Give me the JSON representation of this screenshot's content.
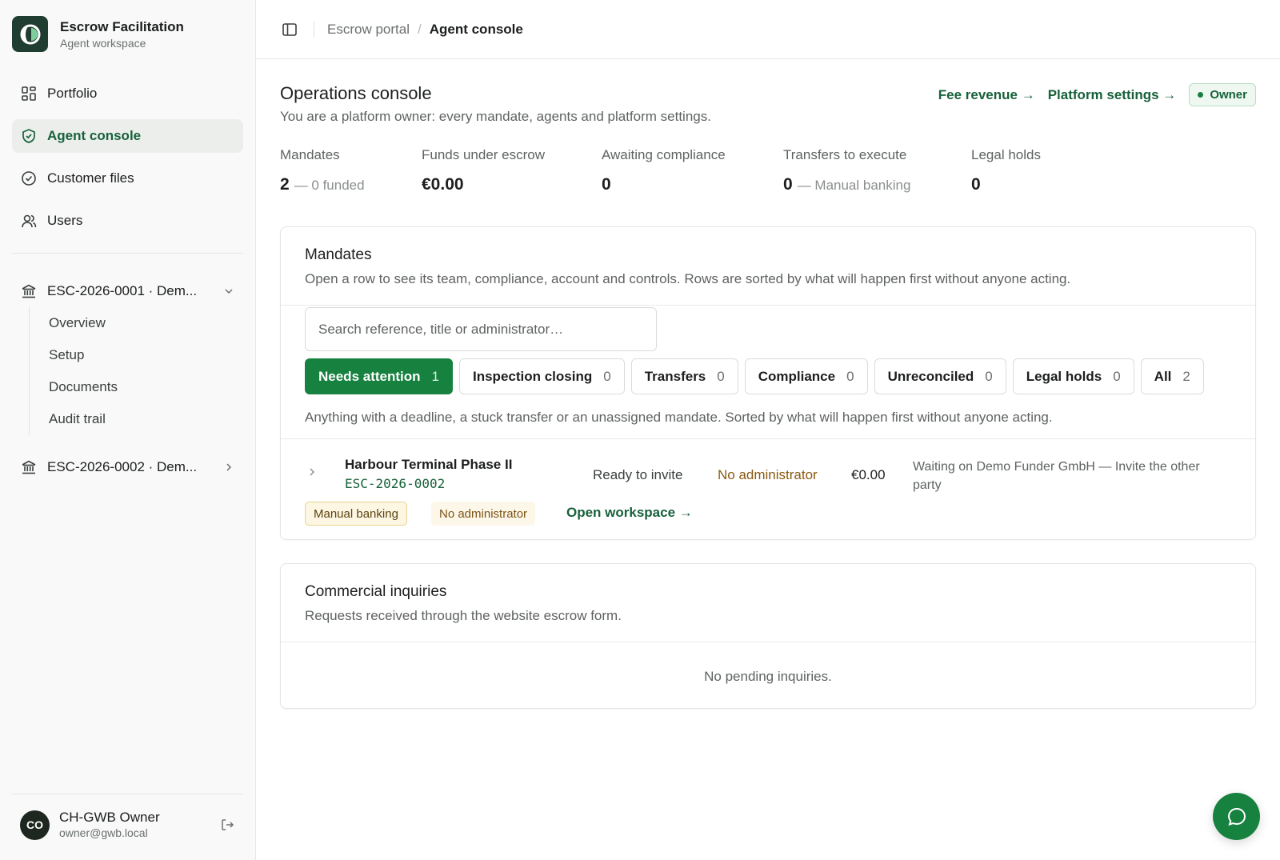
{
  "app": {
    "title": "Escrow Facilitation",
    "subtitle": "Agent workspace"
  },
  "sidebar": {
    "items": [
      {
        "label": "Portfolio",
        "icon": "grid-icon"
      },
      {
        "label": "Agent console",
        "icon": "shield-check-icon",
        "active": true
      },
      {
        "label": "Customer files",
        "icon": "check-circle-icon"
      },
      {
        "label": "Users",
        "icon": "users-icon"
      }
    ],
    "mandates": [
      {
        "label": "ESC-2026-0001 · Dem...",
        "expanded": true,
        "subitems": [
          "Overview",
          "Setup",
          "Documents",
          "Audit trail"
        ]
      },
      {
        "label": "ESC-2026-0002 · Dem...",
        "expanded": false
      }
    ],
    "user": {
      "initials": "CO",
      "name": "CH-GWB Owner",
      "email": "owner@gwb.local"
    }
  },
  "topbar": {
    "breadcrumb_root": "Escrow portal",
    "breadcrumb_separator": "/",
    "breadcrumb_current": "Agent console"
  },
  "main": {
    "title": "Operations console",
    "subtitle": "You are a platform owner: every mandate, agents and platform settings.",
    "fee_revenue_link": "Fee revenue →",
    "platform_settings_link": "Platform settings →",
    "role_badge": "Owner",
    "stats": [
      {
        "label": "Mandates",
        "value": "2",
        "note": "— 0 funded"
      },
      {
        "label": "Funds under escrow",
        "value": "€0.00",
        "note": ""
      },
      {
        "label": "Awaiting compliance",
        "value": "0",
        "note": ""
      },
      {
        "label": "Transfers to execute",
        "value": "0",
        "note": "— Manual banking"
      },
      {
        "label": "Legal holds",
        "value": "0",
        "note": ""
      }
    ],
    "mandates_card": {
      "title": "Mandates",
      "subtitle": "Open a row to see its team, compliance, account and controls. Rows are sorted by what will happen first without anyone acting.",
      "search_placeholder": "Search reference, title or administrator…",
      "filters": [
        {
          "label": "Needs attention",
          "count": "1",
          "active": true
        },
        {
          "label": "Inspection closing",
          "count": "0"
        },
        {
          "label": "Transfers",
          "count": "0"
        },
        {
          "label": "Compliance",
          "count": "0"
        },
        {
          "label": "Unreconciled",
          "count": "0"
        },
        {
          "label": "Legal holds",
          "count": "0"
        },
        {
          "label": "All",
          "count": "2"
        }
      ],
      "filter_note": "Anything with a deadline, a stuck transfer or an unassigned mandate. Sorted by what will happen first without anyone acting.",
      "rows": [
        {
          "title": "Harbour Terminal Phase II",
          "reference": "ESC-2026-0002",
          "status": "Ready to invite",
          "administrator": "No administrator",
          "amount": "€0.00",
          "waiting": "Waiting on Demo Funder GmbH — Invite the other party",
          "tag_banking": "Manual banking",
          "tag_admin": "No administrator",
          "link": "Open workspace →"
        }
      ]
    },
    "inquiries_card": {
      "title": "Commercial inquiries",
      "subtitle": "Requests received through the website escrow form.",
      "empty": "No pending inquiries."
    }
  },
  "colors": {
    "accent": "#17813f",
    "accent_text": "#17613a",
    "warning_text": "#8a5a12",
    "brand_dark": "#1f3d30"
  }
}
